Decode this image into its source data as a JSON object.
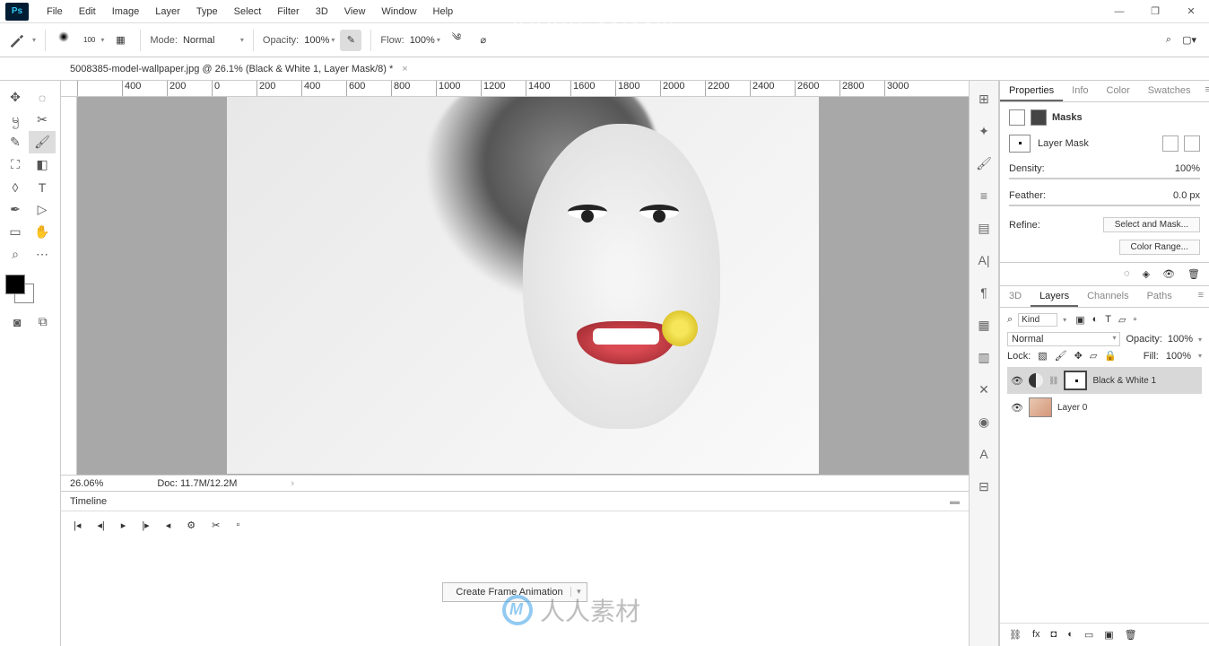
{
  "watermark_url": "www.rr-sc.com",
  "watermark_bottom": "人人素材",
  "menu": [
    "File",
    "Edit",
    "Image",
    "Layer",
    "Type",
    "Select",
    "Filter",
    "3D",
    "View",
    "Window",
    "Help"
  ],
  "options": {
    "brush_size": "100",
    "mode_label": "Mode:",
    "mode_value": "Normal",
    "opacity_label": "Opacity:",
    "opacity_value": "100%",
    "flow_label": "Flow:",
    "flow_value": "100%"
  },
  "doc_tab": "5008385-model-wallpaper.jpg @ 26.1% (Black & White 1, Layer Mask/8) *",
  "ruler_marks": [
    "",
    "400",
    "200",
    "0",
    "200",
    "400",
    "600",
    "800",
    "1000",
    "1200",
    "1400",
    "1600",
    "1800",
    "2000",
    "2200",
    "2400",
    "2600",
    "2800",
    "3000"
  ],
  "status": {
    "zoom": "26.06%",
    "doc": "Doc: 11.7M/12.2M"
  },
  "timeline": {
    "title": "Timeline",
    "cfa": "Create Frame Animation"
  },
  "properties": {
    "tabs": [
      "Properties",
      "Info",
      "Color",
      "Swatches"
    ],
    "masks_title": "Masks",
    "layer_mask": "Layer Mask",
    "density_label": "Density:",
    "density_value": "100%",
    "feather_label": "Feather:",
    "feather_value": "0.0 px",
    "refine_label": "Refine:",
    "select_mask": "Select and Mask...",
    "color_range": "Color Range..."
  },
  "layers_panel": {
    "tabs": [
      "3D",
      "Layers",
      "Channels",
      "Paths"
    ],
    "kind": "Kind",
    "blend": "Normal",
    "opacity_label": "Opacity:",
    "opacity_value": "100%",
    "lock_label": "Lock:",
    "fill_label": "Fill:",
    "fill_value": "100%",
    "layers": [
      {
        "name": "Black & White 1"
      },
      {
        "name": "Layer 0"
      }
    ]
  }
}
